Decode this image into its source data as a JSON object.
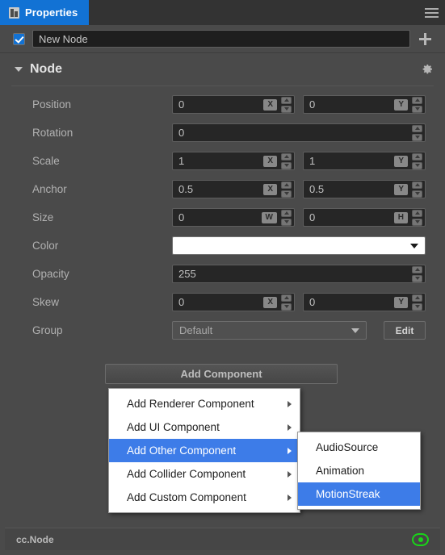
{
  "tab": {
    "label": "Properties",
    "icon": "properties-list-icon",
    "menu_icon": "hamburger-icon"
  },
  "node_name": {
    "enabled": true,
    "value": "New Node",
    "add_icon": "plus-icon"
  },
  "section": {
    "title": "Node",
    "collapsed": false,
    "settings_icon": "gear-icon"
  },
  "properties": [
    {
      "label": "Position",
      "type": "vec2",
      "x": "0",
      "y": "0",
      "tag_x": "X",
      "tag_y": "Y"
    },
    {
      "label": "Rotation",
      "type": "num",
      "value": "0"
    },
    {
      "label": "Scale",
      "type": "vec2",
      "x": "1",
      "y": "1",
      "tag_x": "X",
      "tag_y": "Y"
    },
    {
      "label": "Anchor",
      "type": "vec2",
      "x": "0.5",
      "y": "0.5",
      "tag_x": "X",
      "tag_y": "Y"
    },
    {
      "label": "Size",
      "type": "vec2",
      "x": "0",
      "y": "0",
      "tag_x": "W",
      "tag_y": "H"
    },
    {
      "label": "Color",
      "type": "color",
      "value": "#ffffff"
    },
    {
      "label": "Opacity",
      "type": "num",
      "value": "255"
    },
    {
      "label": "Skew",
      "type": "vec2",
      "x": "0",
      "y": "0",
      "tag_x": "X",
      "tag_y": "Y"
    },
    {
      "label": "Group",
      "type": "select",
      "value": "Default",
      "button": "Edit"
    }
  ],
  "add_component": {
    "label": "Add Component"
  },
  "menu_primary": {
    "items": [
      {
        "label": "Add Renderer Component",
        "submenu": true,
        "selected": false
      },
      {
        "label": "Add UI Component",
        "submenu": true,
        "selected": false
      },
      {
        "label": "Add Other Component",
        "submenu": true,
        "selected": true
      },
      {
        "label": "Add Collider Component",
        "submenu": true,
        "selected": false
      },
      {
        "label": "Add Custom Component",
        "submenu": true,
        "selected": false
      }
    ]
  },
  "menu_submenu": {
    "items": [
      {
        "label": "AudioSource",
        "selected": false
      },
      {
        "label": "Animation",
        "selected": false
      },
      {
        "label": "MotionStreak",
        "selected": true
      }
    ]
  },
  "status": {
    "text": "cc.Node",
    "visibility_icon": "eye-icon"
  },
  "colors": {
    "accent": "#1272d4",
    "menu_highlight": "#3d7ce8",
    "panel_bg": "#4a4a4a",
    "field_bg": "#262626",
    "status_indicator": "#18d618"
  }
}
